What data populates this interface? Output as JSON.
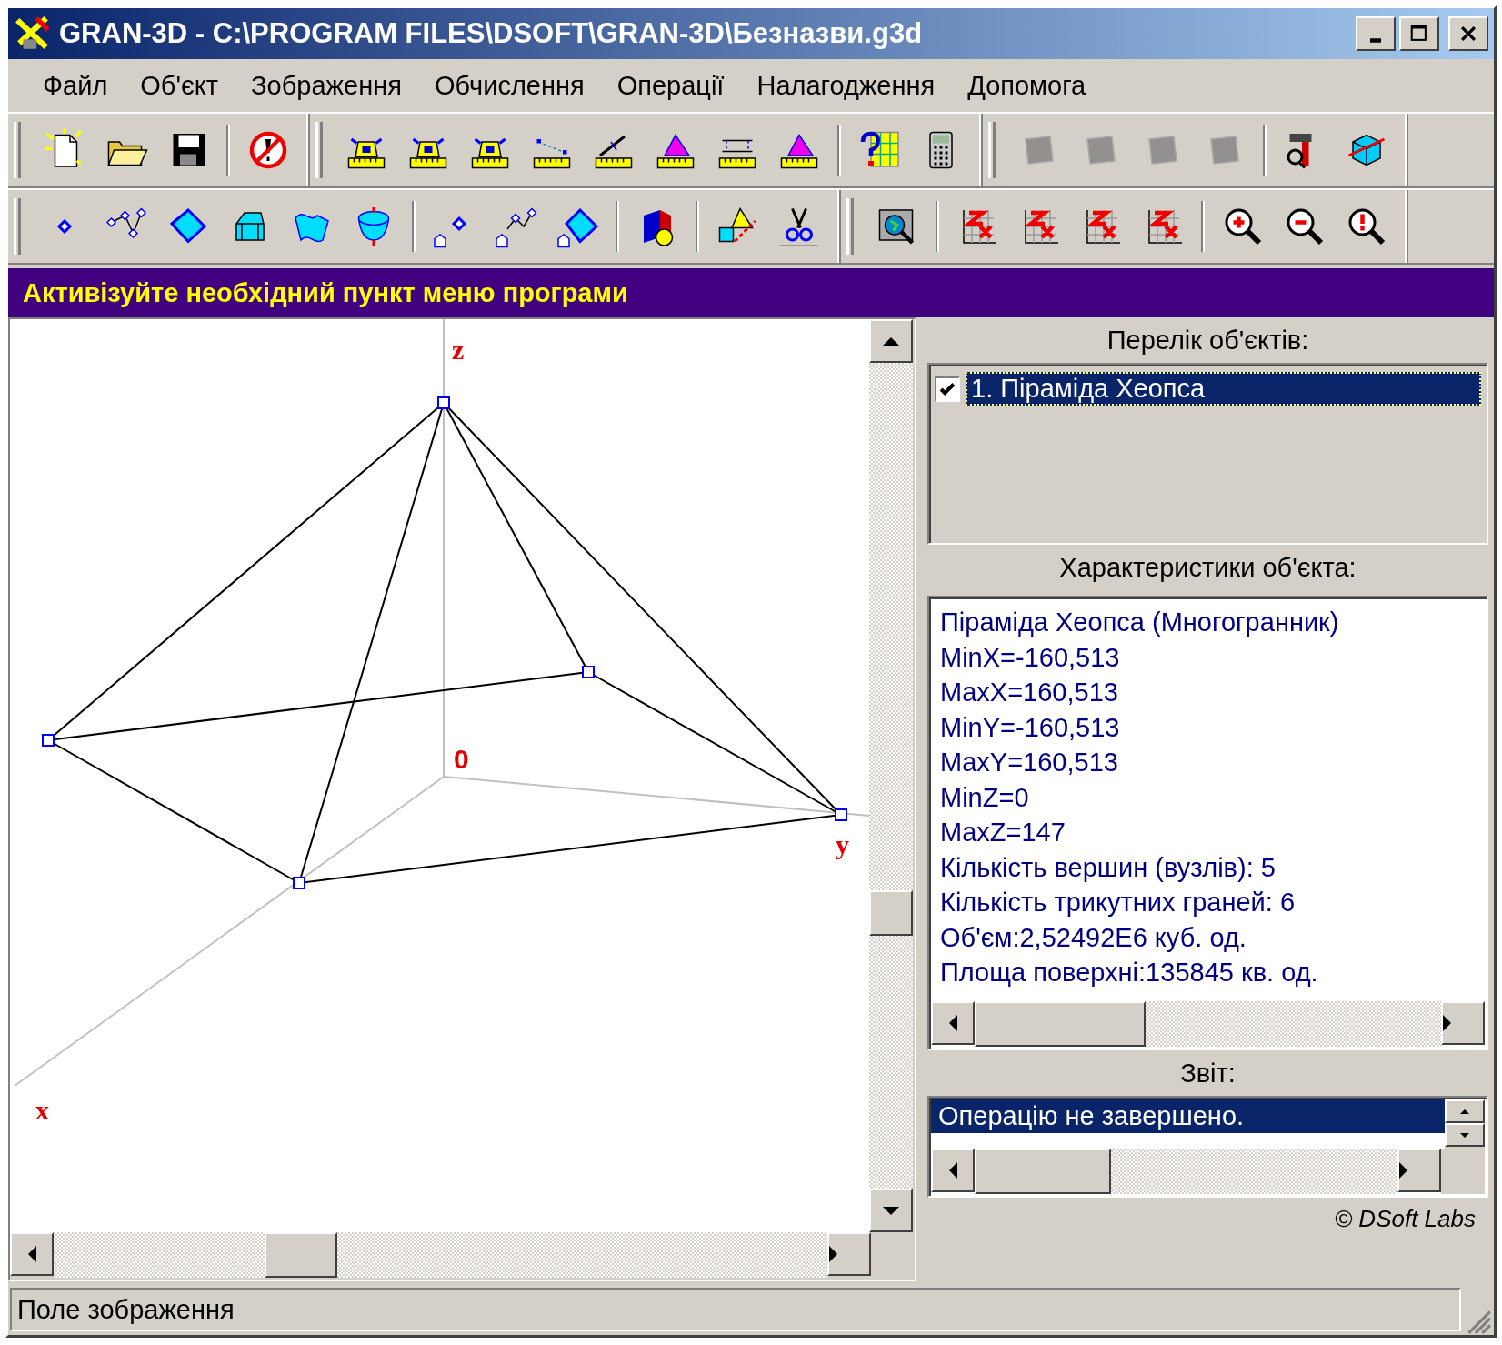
{
  "window": {
    "title": "GRAN-3D - C:\\PROGRAM FILES\\DSOFT\\GRAN-3D\\Безназви.g3d"
  },
  "menu": [
    "Файл",
    "Об'єкт",
    "Зображення",
    "Обчислення",
    "Операції",
    "Налагодження",
    "Допомога"
  ],
  "toolbars": [
    [
      [
        [
          {
            "kind": "new",
            "disabled": false
          },
          {
            "kind": "open",
            "disabled": false
          },
          {
            "kind": "save",
            "disabled": false
          }
        ],
        [
          {
            "kind": "stop",
            "disabled": false
          }
        ]
      ],
      [
        [
          {
            "kind": "ruler-solid",
            "disabled": false
          },
          {
            "kind": "ruler-solid",
            "disabled": false
          },
          {
            "kind": "ruler-solid",
            "disabled": false
          },
          {
            "kind": "ruler-segment",
            "disabled": false
          },
          {
            "kind": "ruler-angle",
            "disabled": false
          },
          {
            "kind": "ruler-triangle",
            "disabled": false
          },
          {
            "kind": "ruler-lines",
            "disabled": false
          },
          {
            "kind": "ruler-triangle",
            "disabled": false
          }
        ],
        [
          {
            "kind": "help",
            "disabled": false
          },
          {
            "kind": "calculator",
            "disabled": false
          }
        ]
      ],
      [
        [
          {
            "kind": "shape",
            "disabled": true
          },
          {
            "kind": "shape",
            "disabled": true
          },
          {
            "kind": "shape",
            "disabled": true
          },
          {
            "kind": "shape",
            "disabled": true
          }
        ],
        [
          {
            "kind": "tools",
            "disabled": false
          },
          {
            "kind": "cube",
            "disabled": false
          }
        ]
      ]
    ],
    [
      [
        [
          {
            "kind": "point",
            "disabled": false
          },
          {
            "kind": "polyline",
            "disabled": false
          },
          {
            "kind": "plane",
            "disabled": false
          },
          {
            "kind": "solid",
            "disabled": false
          },
          {
            "kind": "surface",
            "disabled": false
          },
          {
            "kind": "vase",
            "disabled": false
          }
        ],
        [
          {
            "kind": "point-tag",
            "disabled": false
          },
          {
            "kind": "polyline-tag",
            "disabled": false
          },
          {
            "kind": "plane-tag",
            "disabled": false
          }
        ],
        [
          {
            "kind": "paint",
            "disabled": false
          }
        ],
        [
          {
            "kind": "transform",
            "disabled": false
          },
          {
            "kind": "cut",
            "disabled": false
          }
        ]
      ],
      [
        [
          {
            "kind": "view",
            "disabled": false
          }
        ],
        [
          {
            "kind": "axes",
            "disabled": false
          },
          {
            "kind": "axes",
            "disabled": false
          },
          {
            "kind": "axes",
            "disabled": false
          },
          {
            "kind": "axes",
            "disabled": false
          }
        ],
        [
          {
            "kind": "zoom-in",
            "disabled": false
          },
          {
            "kind": "zoom-out",
            "disabled": false
          },
          {
            "kind": "zoom-reset",
            "disabled": false
          }
        ]
      ]
    ]
  ],
  "message": "Активізуйте необхідний пункт меню програми",
  "view": {
    "axis_labels": [
      {
        "kind": "z",
        "text": "z"
      },
      {
        "kind": "origin",
        "text": "0"
      },
      {
        "kind": "y",
        "text": "y"
      },
      {
        "kind": "x",
        "text": "x"
      }
    ]
  },
  "objects_panel": {
    "title": "Перелік об'єктів:",
    "items": [
      {
        "label": "1. Піраміда Хеопса",
        "checked": true,
        "selected": true
      }
    ]
  },
  "properties_panel": {
    "title": "Характеристики об'єкта:",
    "lines": [
      "Піраміда Хеопса (Многогранник)",
      "MinX=-160,513",
      "MaxX=160,513",
      "MinY=-160,513",
      "MaxY=160,513",
      "MinZ=0",
      "MaxZ=147",
      "Кількість вершин (вузлів): 5",
      "Кількість трикутних граней: 6",
      "Об'єм:2,52492E6 куб. од.",
      "Площа поверхні:135845 кв. од."
    ]
  },
  "report_panel": {
    "title": "Звіт:",
    "lines": [
      {
        "text": "Операцію не завершено.",
        "selected": true
      }
    ]
  },
  "copyright": "© DSoft Labs",
  "status_bar": "Поле зображення"
}
